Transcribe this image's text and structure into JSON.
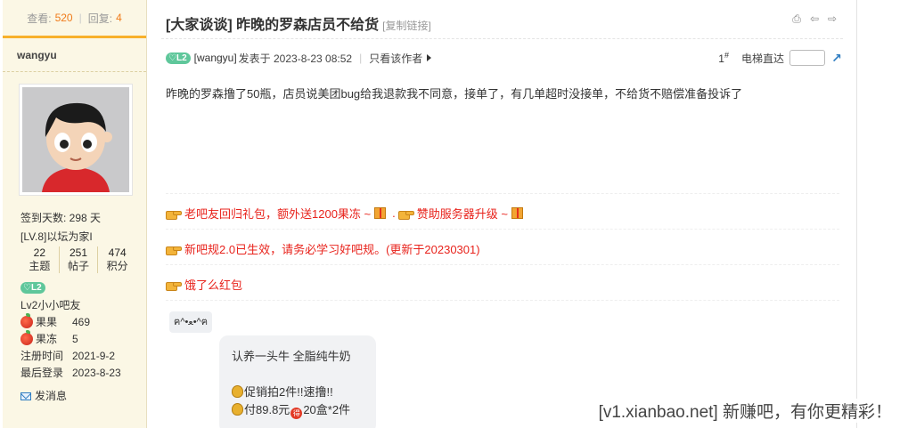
{
  "sidebar": {
    "views_label": "查看:",
    "views": "520",
    "replies_label": "回复:",
    "replies": "4",
    "username": "wangyu",
    "checkin": "签到天数: 298 天",
    "level_text": "[LV.8]以坛为家I",
    "stats": [
      {
        "value": "22",
        "label": "主题"
      },
      {
        "value": "251",
        "label": "帖子"
      },
      {
        "value": "474",
        "label": "积分"
      }
    ],
    "badge": "L2",
    "rank": "Lv2小小吧友",
    "fruit_label": "果果",
    "fruit_value": "469",
    "jelly_label": "果冻",
    "jelly_value": "5",
    "reg_label": "注册时间",
    "reg_value": "2021-9-2",
    "last_label": "最后登录",
    "last_value": "2023-8-23",
    "send_msg": "发消息"
  },
  "post": {
    "title": "[大家谈谈] 昨晚的罗森店员不给货",
    "copy_link": "[复制链接]",
    "badge": "L2",
    "author": "[wangyu]",
    "posted": "发表于 2023-8-23 08:52",
    "only_author": "只看该作者",
    "floor": "1",
    "floor_sup": "#",
    "goto_label": "电梯直达",
    "goto_btn": "↗",
    "body": "昨晚的罗森撸了50瓶，店员说美团bug给我退款我不同意，接单了，有几单超时没接单，不给货不赔偿准备投诉了"
  },
  "ads": {
    "line1a": "老吧友回归礼包，额外送1200果冻 ~",
    "line1_sep": ".",
    "line1b": "赞助服务器升级 ~",
    "line2": "新吧规2.0已生效，请务必学习好吧规。(更新于20230301)",
    "line3": "饿了么红包"
  },
  "quote": {
    "emoji": "ฅ^•ﻌ•^ฅ",
    "line1": "认养一头牛 全脂纯牛奶",
    "line2": "促销拍2件!!速撸!!",
    "line3a": "付89.8元",
    "red_coin": "得",
    "line3b": "20盒*2件"
  },
  "watermark": "[v1.xianbao.net] 新赚吧，有你更精彩！",
  "colors": {
    "accent_orange": "#f7b02b",
    "ad_red": "#e8231c",
    "badge_green": "#5fc79b",
    "sidebar_bg": "#fbf7e5"
  }
}
